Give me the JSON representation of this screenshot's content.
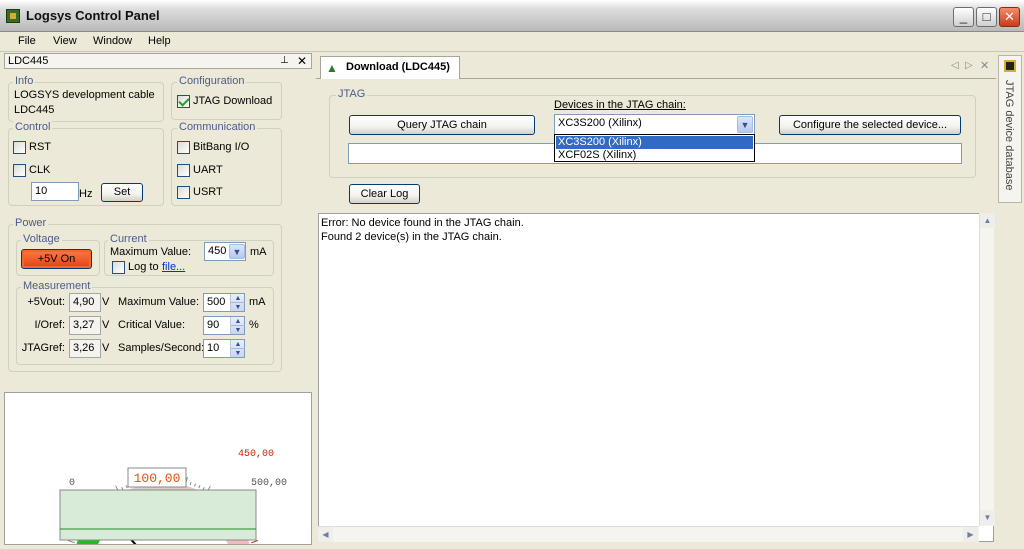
{
  "window": {
    "title": "Logsys Control Panel",
    "min": "_",
    "max": "□",
    "close": "✕"
  },
  "menu": [
    "File",
    "View",
    "Window",
    "Help"
  ],
  "left_panel": {
    "title": "LDC445",
    "pin": "⊥",
    "close": "✕",
    "info": {
      "legend": "Info",
      "line1": "LOGSYS development cable",
      "line2": "LDC445"
    },
    "configuration": {
      "legend": "Configuration",
      "jtag_download": "JTAG Download",
      "jtag_checked": true
    },
    "control": {
      "legend": "Control",
      "rst": "RST",
      "clk": "CLK",
      "freq_value": "10",
      "freq_unit": "Hz",
      "set_label": "Set"
    },
    "communication": {
      "legend": "Communication",
      "bitbang": "BitBang I/O",
      "uart": "UART",
      "usrt": "USRT"
    },
    "power": {
      "legend": "Power",
      "voltage": {
        "legend": "Voltage",
        "button": "+5V On"
      },
      "current": {
        "legend": "Current",
        "max_label": "Maximum Value:",
        "max_value": "450",
        "unit": "mA",
        "log_label": "Log to",
        "file_link": "file..."
      },
      "measurement": {
        "legend": "Measurement",
        "rows": [
          {
            "name": "+5Vout:",
            "value": "4,90",
            "unit": "V",
            "param": "Maximum Value:",
            "pvalue": "500",
            "punit": "mA"
          },
          {
            "name": "I/Oref:",
            "value": "3,27",
            "unit": "V",
            "param": "Critical Value:",
            "pvalue": "90",
            "punit": "%"
          },
          {
            "name": "JTAGref:",
            "value": "3,26",
            "unit": "V",
            "param": "Samples/Second:",
            "pvalue": "10",
            "punit": ""
          }
        ]
      }
    },
    "gauge": {
      "value_text": "100,00",
      "max_label": "450,00",
      "full_label": "500,00",
      "zero_label": "0",
      "value": 100,
      "critical": 450,
      "max": 500
    }
  },
  "tab": {
    "label": "Download (LDC445)",
    "prev": "◁",
    "next": "▷",
    "close": "✕"
  },
  "jtag": {
    "legend": "JTAG",
    "query_button": "Query JTAG chain",
    "devices_label": "Devices in the JTAG chain:",
    "selected": "XC3S200 (Xilinx)",
    "options": [
      "XC3S200 (Xilinx)",
      "XCF02S (Xilinx)"
    ],
    "configure_button": "Configure the selected device...",
    "clear_log": "Clear Log"
  },
  "log": [
    "Error: No device found in the JTAG chain.",
    "Found 2 device(s) in the JTAG chain."
  ],
  "sidetab": {
    "label": "JTAG device database"
  },
  "colors": {
    "power_on": "#f26730",
    "gauge_green": "#22bb22",
    "gauge_red": "#cc2200"
  }
}
